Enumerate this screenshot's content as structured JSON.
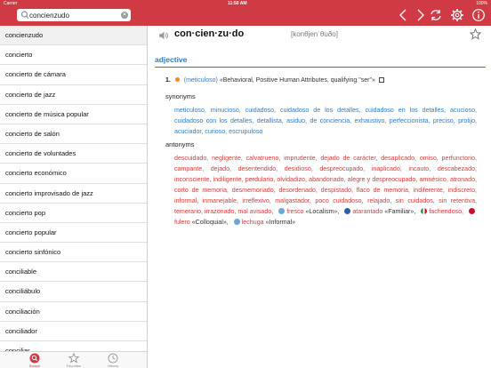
{
  "status": {
    "carrier": "Carrier",
    "time": "11:50 AM",
    "battery": "100%"
  },
  "search": {
    "value": "concienzudo",
    "placeholder": ""
  },
  "colors": {
    "accent": "#cf3a45",
    "link": "#2a7cc7",
    "antonym": "#d43a3a"
  },
  "header_icons": [
    "back-arrow-icon",
    "forward-arrow-icon",
    "refresh-icon",
    "gear-icon",
    "info-icon"
  ],
  "sidebar": {
    "items": [
      "concienzudo",
      "concierto",
      "concierto de cámara",
      "concierto de jazz",
      "concierto de música popular",
      "concierto de salón",
      "concierto de voluntades",
      "concierto económico",
      "concierto improvisado de jazz",
      "concierto pop",
      "concierto popular",
      "concierto sinfónico",
      "conciliable",
      "conciliábulo",
      "conciliación",
      "conciliador",
      "conciliar"
    ]
  },
  "tabs": [
    {
      "label": "Search",
      "icon": "search-icon",
      "active": true
    },
    {
      "label": "Favorites",
      "icon": "star-icon",
      "active": false
    },
    {
      "label": "History",
      "icon": "clock-icon",
      "active": false
    }
  ],
  "entry": {
    "headword": "con·cien·zu·do",
    "pronunciation": "[konθjenˈθuðo]",
    "pos": "adjective",
    "sense": {
      "number": "1.",
      "main": "(meticuloso)",
      "categories": "«Behavioral, Positive Human Attributes, qualifying \"ser\"»"
    },
    "synonyms_title": "synonyms",
    "synonyms": "meticuloso, minucioso, cuidadoso, cuidadoso de los detalles, cuidadoso en los detalles, acucioso, cuidadoso con los detalles, detallista, asiduo, de conciencia, exhaustivo, perfeccionista, preciso, prolijo, acuciador, curioso, escrupuloso",
    "antonyms_title": "antonyms",
    "antonyms": "descuidado, negligente, calvatrueno, imprudente, dejado de carácter, desaplicado, omiso, perfunctorio, campante, dejado, desentendido, desidioso, despreocupado, inaplicado, incauto, descabezado, inconsciente, indiligente, perdulario, olvidadizo, abandonado, alegre y despreocupado, amnésico, atronado, corto de memoria, desmemoriado, desordenado, despistado, flaco de memoria, indiferente, indiscreto, informal, inmanejable, irreflexivo, malgastador, poco cuidadoso, relajado, sin cuidados, sin retentiva, temerario, irrazonado, mal avisado,",
    "ant_regional": [
      {
        "word": "fresco",
        "register": "«Localism»,",
        "flag": "#6aa6d8"
      },
      {
        "word": "atarantado",
        "register": "«Familiar»,",
        "flag": "#2d5fa8"
      },
      {
        "word": "fachendoso,",
        "register": "",
        "flag": "#2e8b3a"
      },
      {
        "word": "fulero",
        "register": "«Colloquial»,",
        "flag": "#c8102e"
      },
      {
        "word": "lechuga",
        "register": "«Informal»",
        "flag": "#6aa6d8"
      }
    ]
  }
}
